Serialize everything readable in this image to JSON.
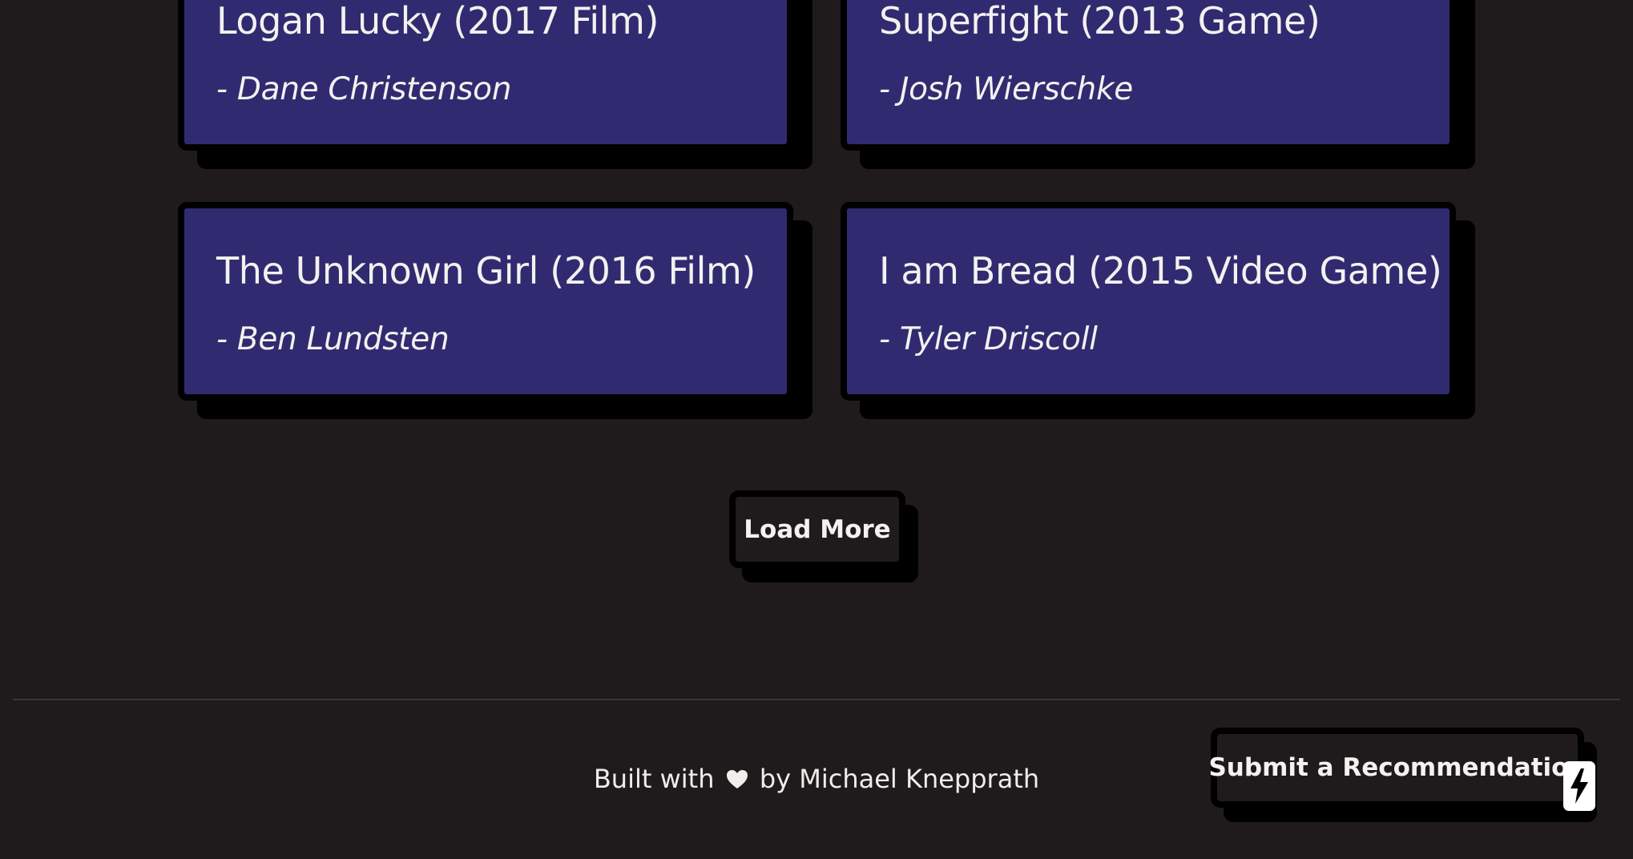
{
  "recommendations": [
    {
      "title": "Logan Lucky (2017 Film)",
      "author": "- Dane Christenson"
    },
    {
      "title": "Superfight (2013 Game)",
      "author": "- Josh Wierschke"
    },
    {
      "title": "The Unknown Girl (2016 Film)",
      "author": "- Ben Lundsten"
    },
    {
      "title": "I am Bread (2015 Video Game)",
      "author": "- Tyler Driscoll"
    }
  ],
  "load_more": {
    "label": "Load More"
  },
  "footer": {
    "built_with": "Built with",
    "by_line": "by Michael Knepprath"
  },
  "submit": {
    "label": "Submit a Recommendation"
  },
  "icons": {
    "heart": "heart-icon",
    "badge": "lightning-bolt-icon"
  },
  "colors": {
    "background": "#1f1b1c",
    "card": "#302b70",
    "border": "#000000",
    "text": "#f3f1ef"
  }
}
